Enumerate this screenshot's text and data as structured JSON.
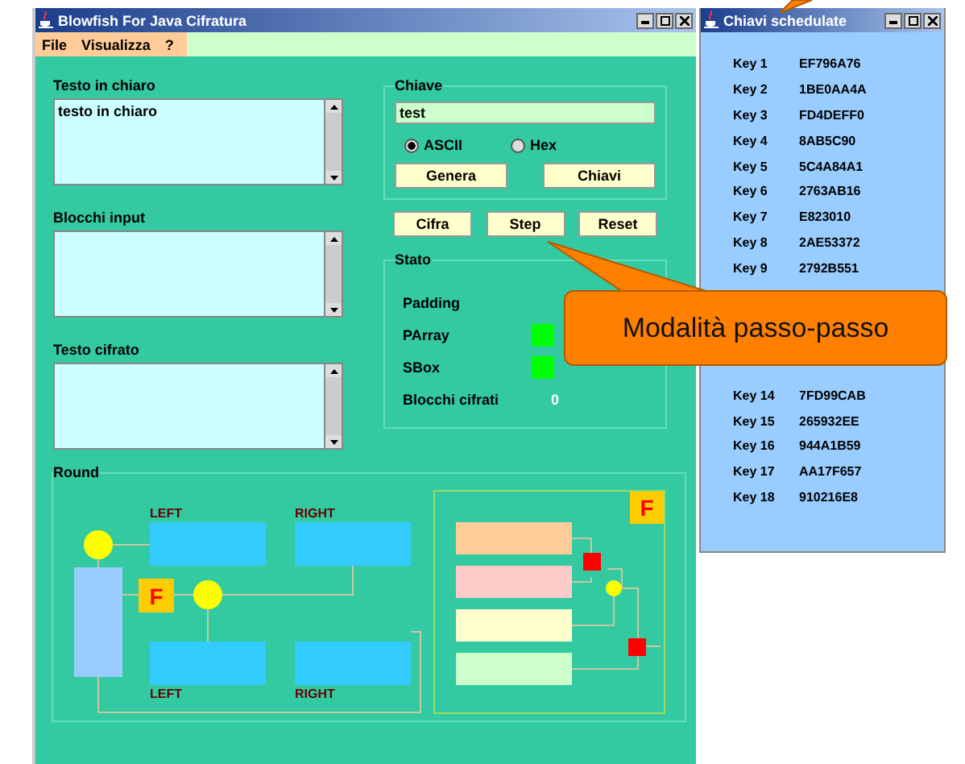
{
  "main_window": {
    "title": "Blowfish For Java Cifratura",
    "menu": [
      "File",
      "Visualizza",
      "?"
    ],
    "text_areas": [
      {
        "label": "Testo in chiaro",
        "value": "testo in chiaro"
      },
      {
        "label": "Blocchi input"
      },
      {
        "label": "Testo cifrato"
      }
    ],
    "key_group": {
      "title": "Chiave",
      "value": "test",
      "encodings": [
        {
          "label": "ASCII",
          "selected": true
        },
        {
          "label": "Hex",
          "selected": false
        }
      ],
      "buttons": [
        "Genera",
        "Chiavi"
      ]
    },
    "actions": [
      "Cifra",
      "Step",
      "Reset"
    ],
    "status_group": {
      "title": "Stato",
      "items": [
        {
          "label": "Padding",
          "kind": "flag",
          "on": false
        },
        {
          "label": "PArray",
          "kind": "flag",
          "on": true
        },
        {
          "label": "SBox",
          "kind": "flag",
          "on": true
        },
        {
          "label": "Blocchi cifrati",
          "kind": "count",
          "value": "0"
        }
      ]
    },
    "round_group": {
      "title": "Round",
      "top_labels": [
        "LEFT",
        "RIGHT"
      ],
      "bottom_labels": [
        "LEFT",
        "RIGHT"
      ],
      "round_function": "F",
      "inner_function": "F"
    }
  },
  "keys_window": {
    "title": "Chiavi schedulate",
    "keys_above": [
      {
        "name": "Key 1",
        "value": "EF796A76"
      },
      {
        "name": "Key 2",
        "value": "1BE0AA4A"
      },
      {
        "name": "Key 3",
        "value": "FD4DEFF0"
      },
      {
        "name": "Key 4",
        "value": "8AB5C90"
      },
      {
        "name": "Key 5",
        "value": "5C4A84A1"
      },
      {
        "name": "Key 6",
        "value": "2763AB16"
      },
      {
        "name": "Key 7",
        "value": "E823010"
      },
      {
        "name": "Key 8",
        "value": "2AE53372"
      },
      {
        "name": "Key 9",
        "value": "2792B551"
      }
    ],
    "keys_below": [
      {
        "name": "Key 14",
        "value": "7FD99CAB"
      },
      {
        "name": "Key 15",
        "value": "265932EE"
      },
      {
        "name": "Key 16",
        "value": "944A1B59"
      },
      {
        "name": "Key 17",
        "value": "AA17F657"
      },
      {
        "name": "Key 18",
        "value": "910216E8"
      }
    ]
  },
  "callout": {
    "text": "Modalità passo-passo"
  }
}
